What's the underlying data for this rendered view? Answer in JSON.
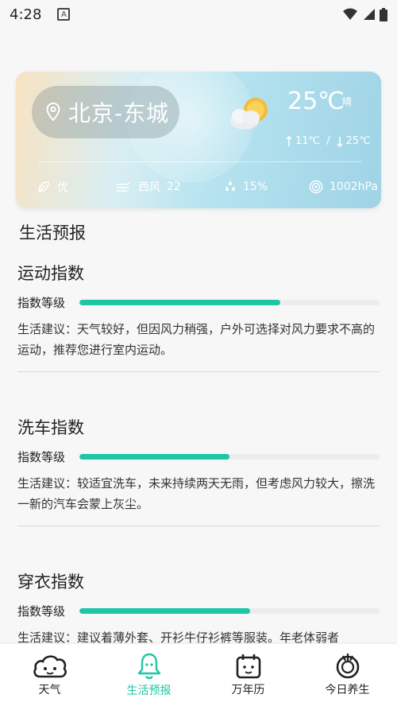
{
  "status_bar": {
    "time": "4:28",
    "app_indicator": "A",
    "icons": [
      "wifi-icon",
      "signal-icon",
      "battery-icon"
    ]
  },
  "weather": {
    "location": "北京-东城",
    "temperature": "25℃",
    "condition": "晴",
    "range_low": "11℃",
    "range_separator": "/",
    "range_high": "25℃",
    "air_quality": "优",
    "wind_dir": "西风",
    "wind_level": "22",
    "humidity": "15%",
    "pressure": "1002hPa"
  },
  "section_title": "生活预报",
  "indices": [
    {
      "title": "运动指数",
      "level_label": "指数等级",
      "level": 0.67,
      "advice": "生活建议：天气较好，但因风力稍强，户外可选择对风力要求不高的运动，推荐您进行室内运动。"
    },
    {
      "title": "洗车指数",
      "level_label": "指数等级",
      "level": 0.5,
      "advice": "生活建议：较适宜洗车，未来持续两天无雨，但考虑风力较大，擦洗一新的汽车会蒙上灰尘。"
    },
    {
      "title": "穿衣指数",
      "level_label": "指数等级",
      "level": 0.57,
      "advice": "生活建议：建议着薄外套、开衫牛仔衫裤等服装。年老体弱者"
    }
  ],
  "tabs": [
    {
      "label": "天气",
      "icon": "cloud-face-icon",
      "active": false
    },
    {
      "label": "生活预报",
      "icon": "bell-icon",
      "active": true
    },
    {
      "label": "万年历",
      "icon": "calendar-icon",
      "active": false
    },
    {
      "label": "今日养生",
      "icon": "wellness-icon",
      "active": false
    }
  ],
  "colors": {
    "accent": "#1ec6a4",
    "track": "#ececec"
  }
}
